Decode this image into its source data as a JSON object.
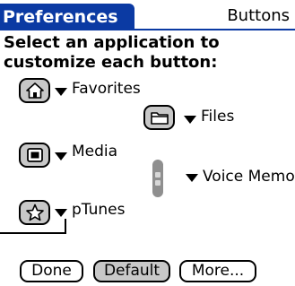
{
  "window": {
    "title": "Preferences",
    "panel": "Buttons"
  },
  "instructions": "Select an application to customize each button:",
  "buttons": [
    {
      "icon": "home-icon",
      "app": "Favorites"
    },
    {
      "icon": "folder-icon",
      "app": "Files"
    },
    {
      "icon": "media-icon",
      "app": "Media"
    },
    {
      "icon": "side-button-icon",
      "app": "Voice Memo"
    },
    {
      "icon": "star-icon",
      "app": "pTunes"
    }
  ],
  "actions": {
    "done": "Done",
    "default": "Default",
    "more": "More..."
  }
}
